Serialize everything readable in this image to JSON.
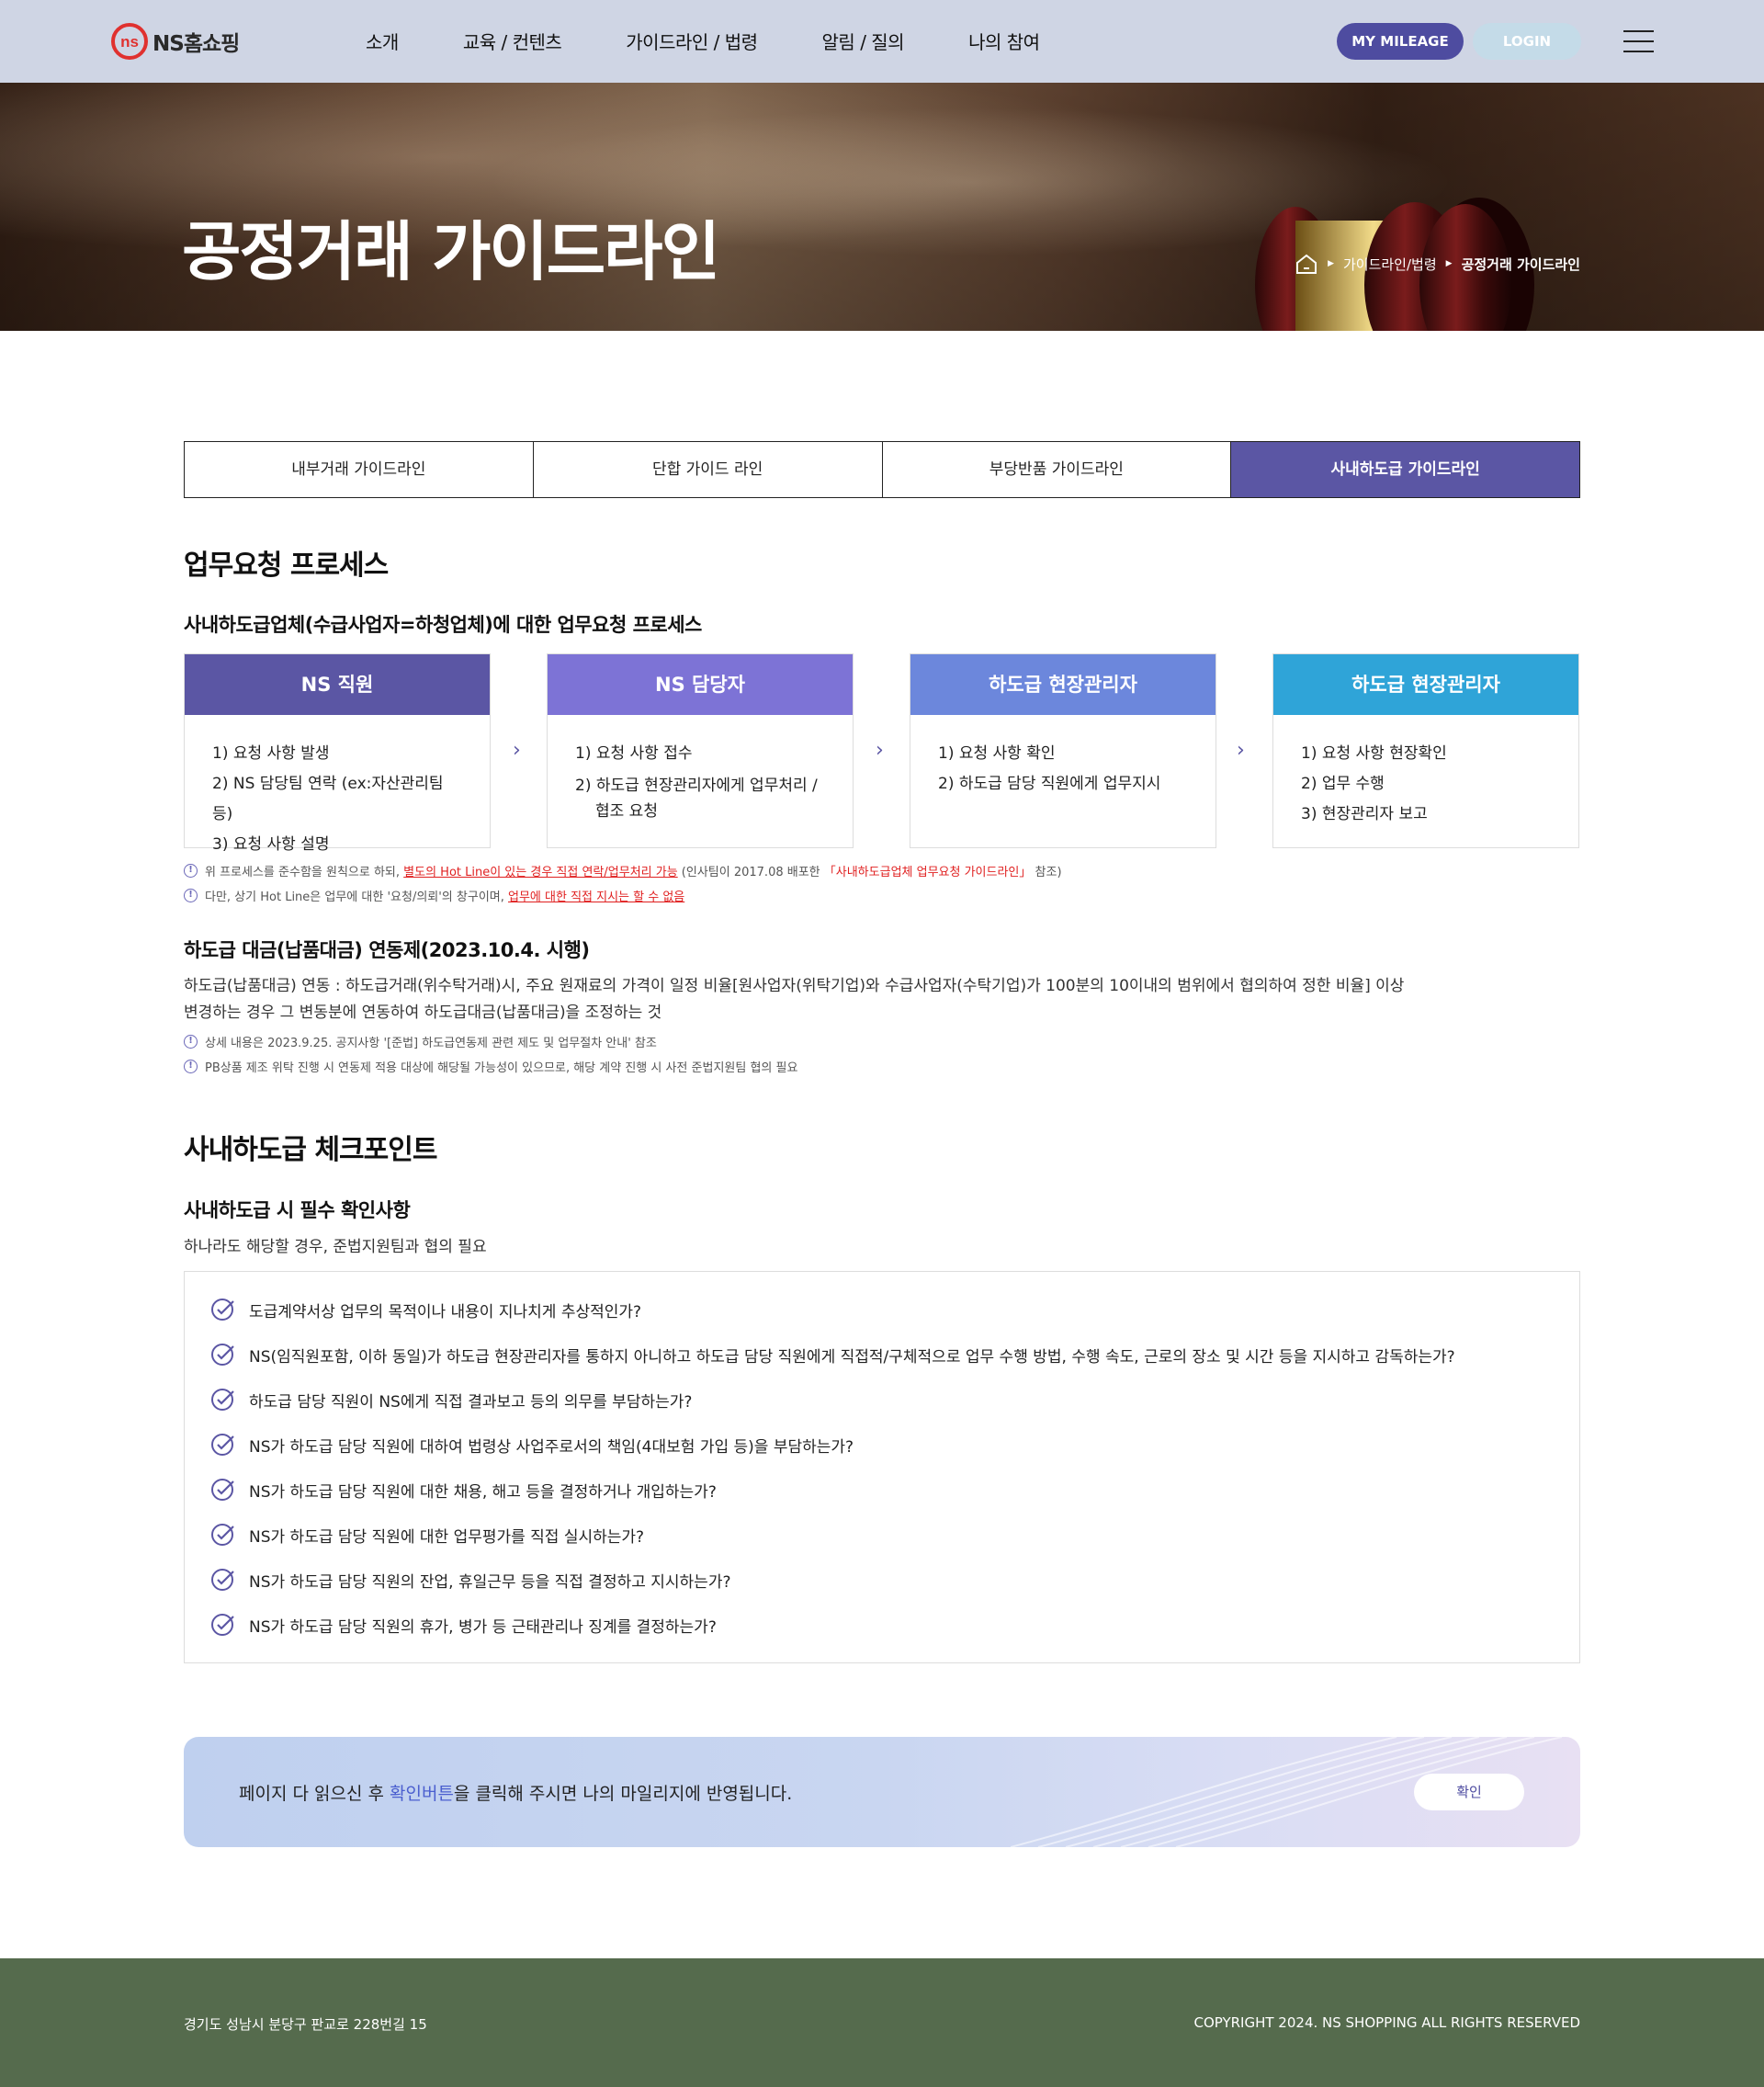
{
  "header": {
    "logo_text": "NS홈쇼핑",
    "nav": [
      "소개",
      "교육 / 컨텐츠",
      "가이드라인 / 법령",
      "알림 / 질의",
      "나의 참여"
    ],
    "mileage_label": "MY MILEAGE",
    "login_label": "LOGIN"
  },
  "hero": {
    "title": "공정거래 가이드라인",
    "breadcrumb": [
      "가이드라인/법령",
      "공정거래 가이드라인"
    ]
  },
  "tabs": [
    "내부거래 가이드라인",
    "단합 가이드 라인",
    "부당반품 가이드라인",
    "사내하도급 가이드라인"
  ],
  "process": {
    "title": "업무요청 프로세스",
    "subtitle": "사내하도급업체(수급사업자=하청업체)에 대한 업무요청 프로세스",
    "steps": [
      {
        "head": "NS 직원",
        "color": "#5b56a4",
        "lines": [
          "1) 요청 사항 발생",
          "2) NS 담당팀 연락 (ex:자산관리팀 등)",
          "3) 요청 사항 설명"
        ]
      },
      {
        "head": "NS 담당자",
        "color": "#7d73d6",
        "lines": [
          "1) 요청 사항 접수",
          "2) 하도급 현장관리자에게 업무처리 /",
          "협조 요청"
        ]
      },
      {
        "head": "하도급 현장관리자",
        "color": "#6c87dc",
        "lines": [
          "1) 요청 사항 확인",
          "2) 하도급 담당 직원에게 업무지시"
        ]
      },
      {
        "head": "하도급 현장관리자",
        "color": "#2fa4d8",
        "lines": [
          "1) 요청 사항 현장확인",
          "2) 업무 수행",
          "3) 현장관리자 보고"
        ]
      }
    ],
    "notes": [
      {
        "a": "위 프로세스를 준수함을 원칙으로 하되, ",
        "b": "별도의 Hot Line이 있는 경우 직접 연락/업무처리 가능",
        "c": " (인사팀이 2017.08 배포한 ",
        "d": "「사내하도급업체 업무요청 가이드라인」",
        "e": " 참조)"
      },
      {
        "a": "다만, 상기 Hot Line은 업무에 대한 '요청/의뢰'의 창구이며, ",
        "b": "업무에 대한 직접 지시는 할 수 없음"
      }
    ]
  },
  "linkage": {
    "title": "하도급 대금(납품대금) 연동제(2023.10.4. 시행)",
    "body1": "하도급(납품대금) 연동 : 하도급거래(위수탁거래)시, 주요 원재료의 가격이 일정 비율[원사업자(위탁기업)와 수급사업자(수탁기업)가 100분의 10이내의 범위에서 협의하여 정한 비율] 이상",
    "body2": "변경하는 경우 그 변동분에 연동하여 하도급대금(납품대금)을 조정하는 것",
    "notes": [
      "상세 내용은 2023.9.25. 공지사항 '[준법] 하도급연동제 관련 제도 및 업무절차 안내' 참조",
      "PB상품 제조 위탁 진행 시 연동제 적용 대상에 해당될 가능성이 있으므로, 해당 계약 진행 시 사전 준법지원팀 협의 필요"
    ]
  },
  "checkpoint": {
    "title": "사내하도급 체크포인트",
    "subtitle": "사내하도급 시 필수 확인사항",
    "desc": "하나라도 해당할 경우, 준법지원팀과 협의 필요",
    "items": [
      "도급계약서상 업무의 목적이나 내용이 지나치게 추상적인가?",
      "NS(임직원포함, 이하 동일)가 하도급 현장관리자를 통하지 아니하고 하도급 담당 직원에게 직접적/구체적으로 업무 수행 방법, 수행 속도, 근로의 장소 및 시간 등을 지시하고 감독하는가?",
      "하도급 담당 직원이 NS에게 직접 결과보고 등의 의무를 부담하는가?",
      "NS가 하도급 담당 직원에 대하여 법령상 사업주로서의 책임(4대보험 가입 등)을 부담하는가?",
      "NS가 하도급 담당 직원에 대한 채용, 해고 등을 결정하거나 개입하는가?",
      "NS가 하도급 담당 직원에 대한 업무평가를 직접 실시하는가?",
      "NS가 하도급 담당 직원의 잔업, 휴일근무 등을 직접 결정하고 지시하는가?",
      "NS가 하도급 담당 직원의 휴가, 병가 등 근태관리나 징계를 결정하는가?"
    ]
  },
  "banner": {
    "text_a": "페이지 다 읽으신 후 ",
    "text_b": "확인버튼",
    "text_c": "을 클릭해 주시면 나의 마일리지에 반영됩니다.",
    "confirm_label": "확인"
  },
  "footer": {
    "address": "경기도 성남시 분당구 판교로 228번길 15",
    "copyright": "COPYRIGHT 2024. NS SHOPPING ALL RIGHTS RESERVED"
  }
}
